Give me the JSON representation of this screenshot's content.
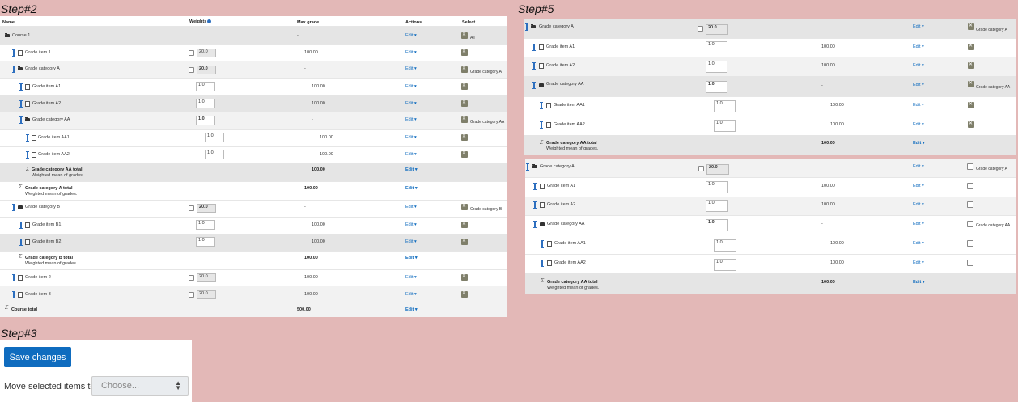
{
  "labels": {
    "step2": "Step#2",
    "step3": "Step#3",
    "step5": "Step#5"
  },
  "headers": {
    "name": "Name",
    "weights": "Weights",
    "max_grade": "Max grade",
    "actions": "Actions",
    "select": "Select"
  },
  "edit_label": "Edit",
  "all_label": "All",
  "step2_rows": [
    {
      "name": "Course 1",
      "max": "-",
      "bold": false
    },
    {
      "name": "Grade item 1",
      "weight": "20.0",
      "max": "100.00",
      "sel_label": ""
    },
    {
      "name": "Grade category A",
      "weight": "20.0",
      "max": "-",
      "sel_label": "Grade category A"
    },
    {
      "name": "Grade item A1",
      "weight": "1.0",
      "max": "100.00"
    },
    {
      "name": "Grade item A2",
      "weight": "1.0",
      "max": "100.00"
    },
    {
      "name": "Grade category AA",
      "weight": "1.0",
      "max": "-",
      "sel_label": "Grade category AA"
    },
    {
      "name": "Grade item AA1",
      "weight": "1.0",
      "max": "100.00"
    },
    {
      "name": "Grade item AA2",
      "weight": "1.0",
      "max": "100.00"
    },
    {
      "name": "Grade category AA total",
      "sub": "Weighted mean of grades.",
      "max": "100.00"
    },
    {
      "name": "Grade category A total",
      "sub": "Weighted mean of grades.",
      "max": "100.00"
    },
    {
      "name": "Grade category B",
      "weight": "20.0",
      "max": "-",
      "sel_label": "Grade category B"
    },
    {
      "name": "Grade item B1",
      "weight": "1.0",
      "max": "100.00"
    },
    {
      "name": "Grade item B2",
      "weight": "1.0",
      "max": "100.00"
    },
    {
      "name": "Grade category B total",
      "sub": "Weighted mean of grades.",
      "max": "100.00"
    },
    {
      "name": "Grade item 2",
      "weight": "20.0",
      "max": "100.00"
    },
    {
      "name": "Grade item 3",
      "weight": "20.0",
      "max": "100.00"
    },
    {
      "name": "Course total",
      "max": "500.00"
    }
  ],
  "step5_rows": [
    {
      "name": "Grade category A",
      "weight": "20.0",
      "max": "-",
      "sel_label": "Grade category A"
    },
    {
      "name": "Grade item A1",
      "weight": "1.0",
      "max": "100.00"
    },
    {
      "name": "Grade item A2",
      "weight": "1.0",
      "max": "100.00"
    },
    {
      "name": "Grade category AA",
      "weight": "1.0",
      "max": "-",
      "sel_label": "Grade category AA"
    },
    {
      "name": "Grade item AA1",
      "weight": "1.0",
      "max": "100.00"
    },
    {
      "name": "Grade item AA2",
      "weight": "1.0",
      "max": "100.00"
    },
    {
      "name": "Grade category AA total",
      "sub": "Weighted mean of grades.",
      "max": "100.00"
    }
  ],
  "step3": {
    "save_label": "Save changes",
    "move_label": "Move selected items to",
    "choose_placeholder": "Choose..."
  }
}
